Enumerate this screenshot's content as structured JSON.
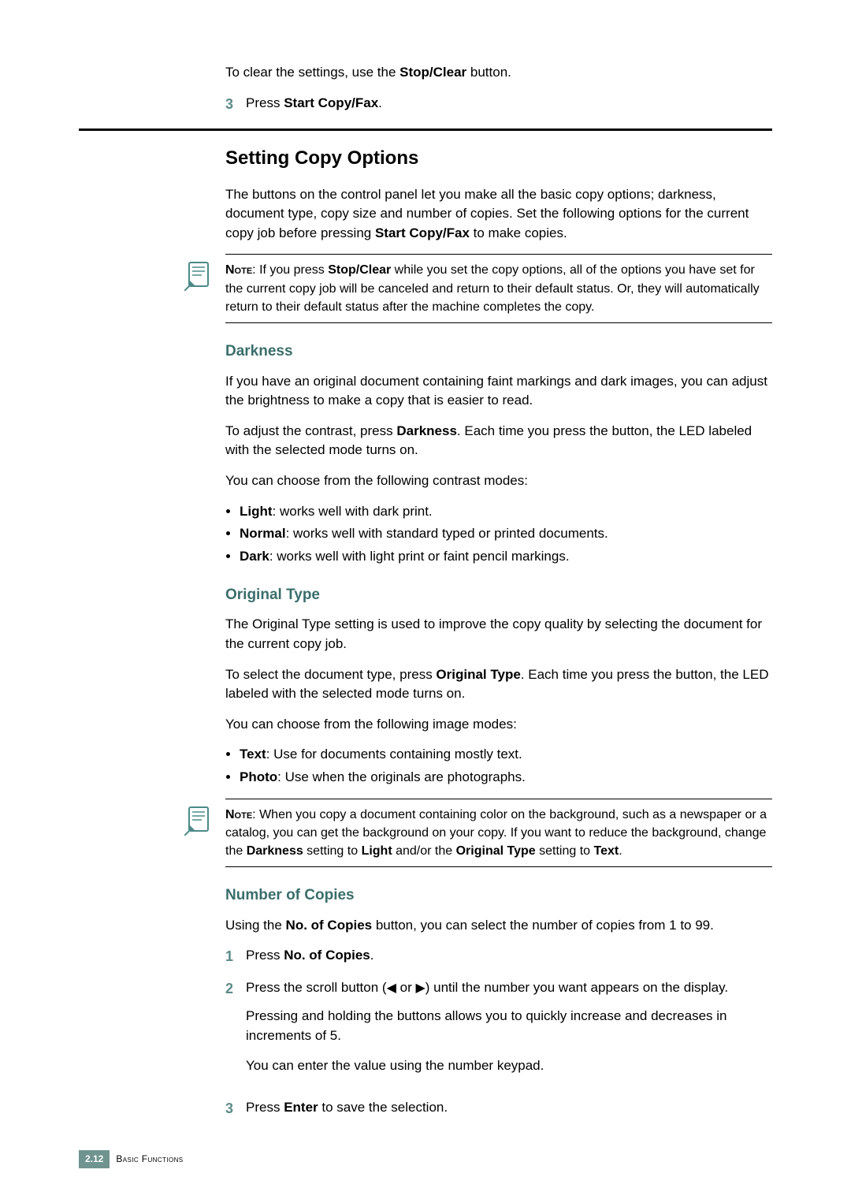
{
  "lead": {
    "clear_settings_pre": "To clear the settings, use the ",
    "stop_clear": "Stop/Clear",
    "clear_settings_post": " button."
  },
  "step_top": {
    "num": "3",
    "press": "Press ",
    "start_copy_fax": "Start Copy/Fax",
    "dot": "."
  },
  "heading": "Setting Copy Options",
  "intro": {
    "p1a": "The buttons on the control panel let you make all the basic copy options; darkness, document type, copy size and number of copies. Set the following options for the current copy job before pressing ",
    "p1b": "Start Copy/Fax",
    "p1c": " to make copies."
  },
  "note1": {
    "label": "Note",
    "a": ": If you press ",
    "b": "Stop/Clear",
    "c": " while you set the copy options, all of the options you have set for the current copy job will be canceled and return to their default status. Or, they will automatically return to their default status after the machine completes the copy."
  },
  "darkness": {
    "title": "Darkness",
    "p1": "If you have an original document containing faint markings and dark images, you can adjust the brightness to make a copy that is easier to read.",
    "p2a": "To adjust the contrast, press ",
    "p2b": "Darkness",
    "p2c": ". Each time you press the button, the LED labeled with the selected mode turns on.",
    "p3": "You can choose from the following contrast modes:",
    "li1b": "Light",
    "li1t": ": works well with dark print.",
    "li2b": "Normal",
    "li2t": ": works well with standard typed or printed documents.",
    "li3b": "Dark",
    "li3t": ": works well with light print or faint pencil markings."
  },
  "origtype": {
    "title": "Original Type",
    "p1": "The Original Type setting is used to improve the copy quality by selecting the document for the current copy job.",
    "p2a": "To select the document type, press ",
    "p2b": "Original Type",
    "p2c": ". Each time you press the button, the LED labeled with the selected mode turns on.",
    "p3": "You can choose from the following image modes:",
    "li1b": "Text",
    "li1t": ": Use for documents containing mostly text.",
    "li2b": "Photo",
    "li2t": ": Use when the originals are photographs."
  },
  "note2": {
    "label": "Note",
    "a": ": When you copy a document containing color on the background, such as a newspaper or a catalog, you can get the background on your copy. If you want to reduce the background, change the ",
    "b": "Darkness",
    "c": " setting to ",
    "d": "Light",
    "e": " and/or the ",
    "f": "Original Type",
    "g": " setting to ",
    "h": "Text",
    "i": "."
  },
  "numcopies": {
    "title": "Number of Copies",
    "p1a": "Using the ",
    "p1b": "No. of Copies",
    "p1c": " button, you can select the number of copies from 1 to 99.",
    "s1n": "1",
    "s1a": "Press ",
    "s1b": "No. of Copies",
    "s1c": ".",
    "s2n": "2",
    "s2a": "Press the scroll button (",
    "s2b": " or ",
    "s2c": ") until the number you want appears on the display.",
    "s2p2": "Pressing and holding the buttons allows you to quickly increase and decreases in increments of 5.",
    "s2p3": "You can enter the value using the number keypad.",
    "s3n": "3",
    "s3a": "Press ",
    "s3b": "Enter",
    "s3c": " to save the selection."
  },
  "footer": {
    "pagenum": "2.12",
    "chapter": "Basic Functions"
  }
}
